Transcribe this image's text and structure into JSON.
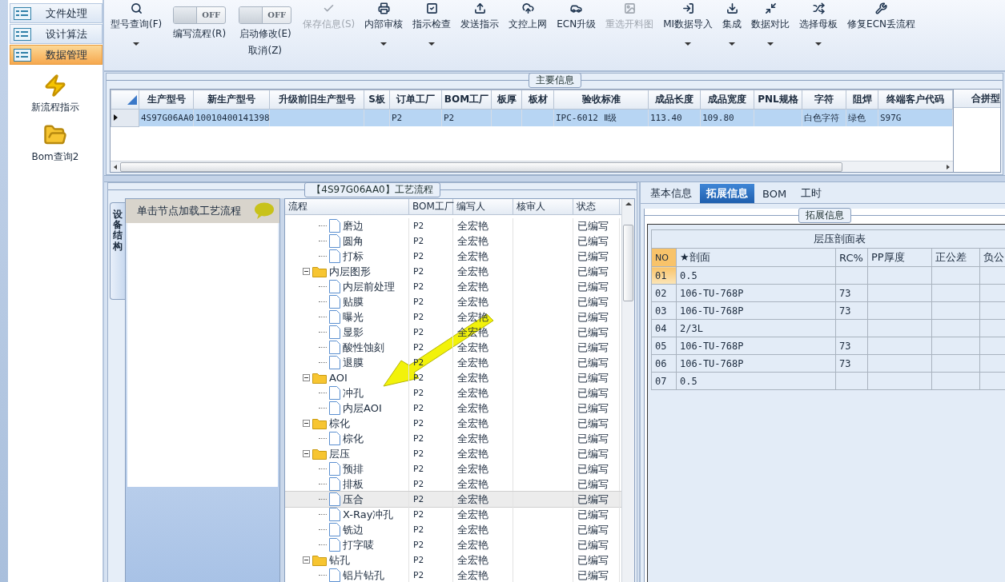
{
  "sidebar": {
    "nav": [
      {
        "label": "文件处理",
        "selected": false
      },
      {
        "label": "设计算法",
        "selected": false
      },
      {
        "label": "数据管理",
        "selected": true
      }
    ],
    "shortcuts": [
      {
        "label": "新流程指示"
      },
      {
        "label": "Bom查询2"
      }
    ]
  },
  "toolbar": [
    {
      "kind": "button",
      "label": "型号查询(F)",
      "disabled": false,
      "dropdown": true
    },
    {
      "kind": "switch",
      "switch_text": "OFF",
      "on": false,
      "label": "编写流程(R)"
    },
    {
      "kind": "switch",
      "switch_text": "OFF",
      "on": false,
      "label": "启动修改(E)",
      "sublabel": "取消(Z)"
    },
    {
      "kind": "button",
      "label": "保存信息(S)",
      "disabled": true,
      "dropdown": false
    },
    {
      "kind": "button",
      "label": "内部审核",
      "disabled": false,
      "dropdown": true
    },
    {
      "kind": "button",
      "label": "指示检查",
      "disabled": false,
      "dropdown": true
    },
    {
      "kind": "button",
      "label": "发送指示",
      "disabled": false,
      "dropdown": false
    },
    {
      "kind": "button",
      "label": "文控上网",
      "disabled": false,
      "dropdown": false
    },
    {
      "kind": "button",
      "label": "ECN升级",
      "disabled": false,
      "dropdown": false
    },
    {
      "kind": "button",
      "label": "重选开料图",
      "disabled": true,
      "dropdown": false
    },
    {
      "kind": "button",
      "label": "MI数据导入",
      "disabled": false,
      "dropdown": true
    },
    {
      "kind": "button",
      "label": "集成",
      "disabled": false,
      "dropdown": true
    },
    {
      "kind": "button",
      "label": "数据对比",
      "disabled": false,
      "dropdown": true
    },
    {
      "kind": "button",
      "label": "选择母板",
      "disabled": false,
      "dropdown": true
    },
    {
      "kind": "button",
      "label": "修复ECN丢流程",
      "disabled": false,
      "dropdown": false
    }
  ],
  "main_info": {
    "title": "主要信息",
    "columns": [
      "生产型号",
      "新生产型号",
      "升级前旧生产型号",
      "S板",
      "订单工厂",
      "BOM工厂",
      "板厚",
      "板材",
      "验收标准",
      "成品长度",
      "成品宽度",
      "PNL规格",
      "字符",
      "阻焊",
      "终端客户代码"
    ],
    "rows": [
      {
        "selected": true,
        "cells": [
          "4S97G06AA0",
          "10010400141398",
          null,
          null,
          "P2",
          "P2",
          null,
          null,
          "IPC-6012 Ⅱ级",
          "113.40",
          "109.80",
          null,
          "白色字符",
          "绿色",
          "S97G"
        ]
      }
    ],
    "side_pane": {
      "header": "合拼型"
    }
  },
  "process": {
    "title": "【4S97G06AA0】工艺流程",
    "side_tab": "设备结构",
    "hint": "单击节点加载工艺流程",
    "columns": [
      "流程",
      "BOM工厂",
      "编写人",
      "核审人",
      "状态"
    ],
    "tree": [
      {
        "children": [
          {
            "label": "磨边",
            "bom_factory": "P2",
            "writer": "全宏艳",
            "status": "已编写",
            "selected": false
          },
          {
            "label": "圆角",
            "bom_factory": "P2",
            "writer": "全宏艳",
            "status": "已编写",
            "selected": false
          },
          {
            "label": "打标",
            "bom_factory": "P2",
            "writer": "全宏艳",
            "status": "已编写",
            "selected": false
          }
        ]
      },
      {
        "label": "内层图形",
        "bom_factory": "P2",
        "writer": "全宏艳",
        "status": "已编写",
        "selected": false,
        "expanded": true,
        "children": [
          {
            "label": "内层前处理",
            "bom_factory": "P2",
            "writer": "全宏艳",
            "status": "已编写",
            "selected": false
          },
          {
            "label": "贴膜",
            "bom_factory": "P2",
            "writer": "全宏艳",
            "status": "已编写",
            "selected": false
          },
          {
            "label": "曝光",
            "bom_factory": "P2",
            "writer": "全宏艳",
            "status": "已编写",
            "selected": false
          },
          {
            "label": "显影",
            "bom_factory": "P2",
            "writer": "全宏艳",
            "status": "已编写",
            "selected": false
          },
          {
            "label": "酸性蚀刻",
            "bom_factory": "P2",
            "writer": "全宏艳",
            "status": "已编写",
            "selected": false
          },
          {
            "label": "退膜",
            "bom_factory": "P2",
            "writer": "全宏艳",
            "status": "已编写",
            "selected": false
          }
        ]
      },
      {
        "label": "AOI",
        "bom_factory": "P2",
        "writer": "全宏艳",
        "status": "已编写",
        "selected": false,
        "expanded": true,
        "children": [
          {
            "label": "冲孔",
            "bom_factory": "P2",
            "writer": "全宏艳",
            "status": "已编写",
            "selected": false
          },
          {
            "label": "内层AOI",
            "bom_factory": "P2",
            "writer": "全宏艳",
            "status": "已编写",
            "selected": false
          }
        ]
      },
      {
        "label": "棕化",
        "bom_factory": "P2",
        "writer": "全宏艳",
        "status": "已编写",
        "selected": false,
        "expanded": true,
        "children": [
          {
            "label": "棕化",
            "bom_factory": "P2",
            "writer": "全宏艳",
            "status": "已编写",
            "selected": false
          }
        ]
      },
      {
        "label": "层压",
        "bom_factory": "P2",
        "writer": "全宏艳",
        "status": "已编写",
        "selected": false,
        "expanded": true,
        "children": [
          {
            "label": "预排",
            "bom_factory": "P2",
            "writer": "全宏艳",
            "status": "已编写",
            "selected": false
          },
          {
            "label": "排板",
            "bom_factory": "P2",
            "writer": "全宏艳",
            "status": "已编写",
            "selected": false
          },
          {
            "label": "压合",
            "bom_factory": "P2",
            "writer": "全宏艳",
            "status": "已编写",
            "selected": true
          },
          {
            "label": "X-Ray冲孔",
            "bom_factory": "P2",
            "writer": "全宏艳",
            "status": "已编写",
            "selected": false
          },
          {
            "label": "铣边",
            "bom_factory": "P2",
            "writer": "全宏艳",
            "status": "已编写",
            "selected": false
          },
          {
            "label": "打字唛",
            "bom_factory": "P2",
            "writer": "全宏艳",
            "status": "已编写",
            "selected": false
          }
        ]
      },
      {
        "label": "钻孔",
        "bom_factory": "P2",
        "writer": "全宏艳",
        "status": "已编写",
        "selected": false,
        "expanded": true,
        "children": [
          {
            "label": "铝片钻孔",
            "bom_factory": "P2",
            "writer": "全宏艳",
            "status": "已编写",
            "selected": false
          }
        ]
      }
    ]
  },
  "details": {
    "tabs": [
      {
        "label": "基本信息",
        "selected": false
      },
      {
        "label": "拓展信息",
        "selected": true
      },
      {
        "label": "BOM",
        "selected": false
      },
      {
        "label": "工时",
        "selected": false
      }
    ],
    "group_title": "拓展信息",
    "table": {
      "title": "层压剖面表",
      "columns": [
        "NO",
        "★剖面",
        "RC%",
        "PP厚度",
        "正公差",
        "负公"
      ],
      "rows": [
        {
          "no": "01",
          "section": "0.5",
          "selected": true
        },
        {
          "no": "02",
          "section": "106-TU-768P",
          "rc": "73",
          "selected": false
        },
        {
          "no": "03",
          "section": "106-TU-768P",
          "rc": "73",
          "selected": false
        },
        {
          "no": "04",
          "section": "2/3L",
          "selected": false
        },
        {
          "no": "05",
          "section": "106-TU-768P",
          "rc": "73",
          "selected": false
        },
        {
          "no": "06",
          "section": "106-TU-768P",
          "rc": "73",
          "selected": false
        },
        {
          "no": "07",
          "section": "0.5",
          "selected": false
        }
      ]
    }
  }
}
